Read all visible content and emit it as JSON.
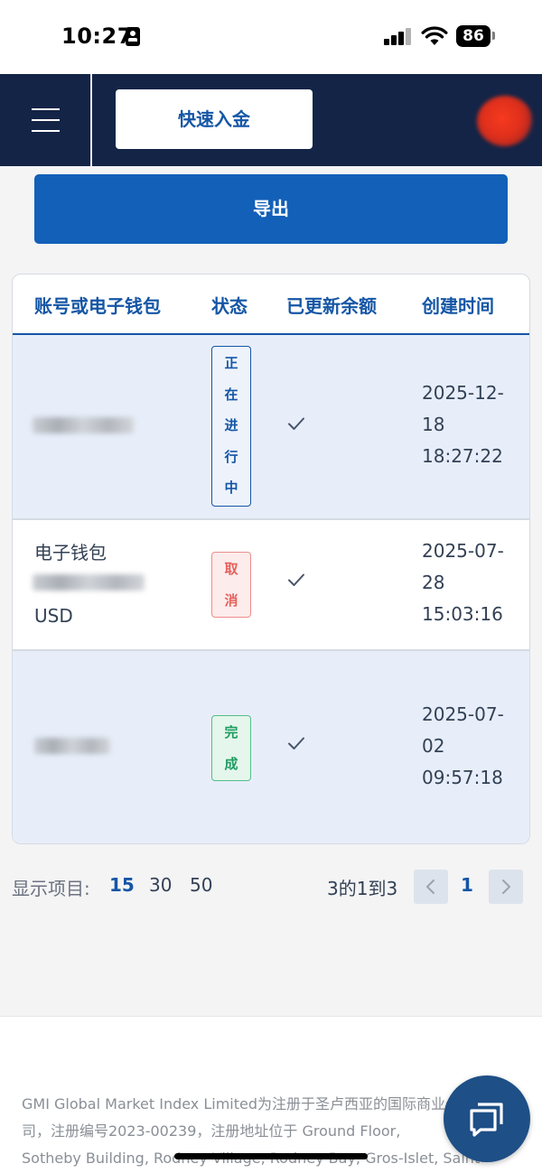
{
  "status_bar": {
    "time": "10:27",
    "battery": "86",
    "icons": [
      "id-card-icon",
      "cellular-signal-icon",
      "wifi-icon",
      "battery-icon"
    ]
  },
  "topbar": {
    "menu_icon": "hamburger-menu-icon",
    "quick_deposit_label": "快速入金",
    "avatar": "user-avatar",
    "bg_color": "#142447"
  },
  "export_label": "导出",
  "table": {
    "headers": {
      "account": "账号或电子钱包",
      "status": "状态",
      "balance_updated": "已更新余额",
      "created_time": "创建时间"
    },
    "rows": [
      {
        "account_line1": "",
        "account_line3": "",
        "status": "正在进行中",
        "status_chars": [
          "正",
          "在",
          "进",
          "行",
          "中"
        ],
        "balance_updated_icon": "check-icon",
        "date": "2025-12-",
        "date2": "18",
        "time": "18:27:22"
      },
      {
        "account_line1": "电子钱包",
        "account_line3": "USD",
        "status": "取消",
        "status_chars": [
          "取",
          "消"
        ],
        "balance_updated_icon": "check-icon",
        "date": "2025-07-",
        "date2": "28",
        "time": "15:03:16"
      },
      {
        "account_line1": "",
        "account_line3": "",
        "status": "完成",
        "status_chars": [
          "完",
          "成"
        ],
        "balance_updated_icon": "check-icon",
        "date": "2025-07-",
        "date2": "02",
        "time": "09:57:18"
      }
    ]
  },
  "pager": {
    "label": "显示项目:",
    "sizes": [
      "15",
      "30",
      "50"
    ],
    "active_size": "15",
    "summary": "3的1到3",
    "current_page": "1",
    "prev_icon": "chevron-left-icon",
    "next_icon": "chevron-right-icon"
  },
  "footer": {
    "text": "GMI Global Market Index Limited为注册于圣卢西亚的国际商业公\n司，注册编号2023-00239，注册地址位于 Ground Floor,\nSotheby Building, Rodney Village, Rodney Bay, Gros-Islet, Saint"
  },
  "chat_icon": "chat-bubble-icon",
  "colors": {
    "accent": "#1556a5",
    "button_blue": "#1260b8",
    "row_alt": "#e7eefa",
    "pending": "#1556a5",
    "cancel": "#e4615c",
    "done": "#1f9d61"
  }
}
